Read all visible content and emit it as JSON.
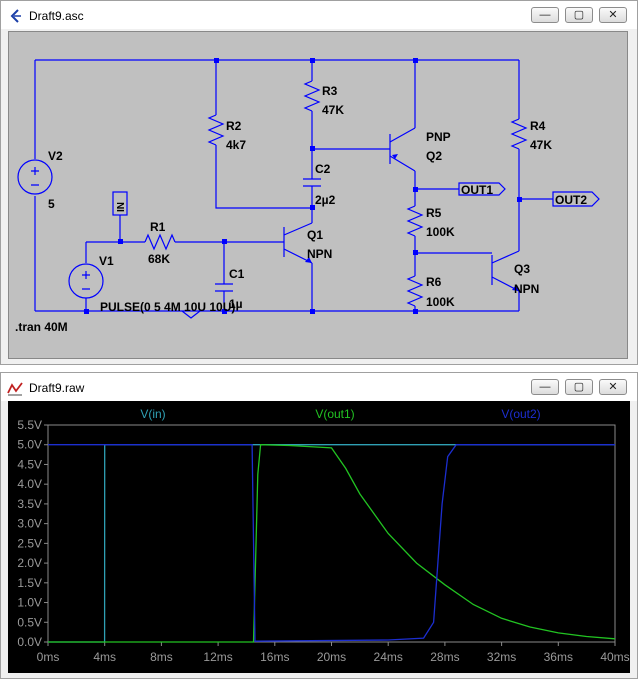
{
  "schematic_window": {
    "title": "Draft9.asc",
    "buttons": {
      "minimize": "—",
      "maximize": "▢",
      "close": "✕"
    },
    "labels": {
      "v2_name": "V2",
      "v2_value": "5",
      "r2_name": "R2",
      "r2_value": "4k7",
      "r3_name": "R3",
      "r3_value": "47K",
      "c2_name": "C2",
      "c2_value": "2µ2",
      "q2_name": "PNP",
      "q2_type": "Q2",
      "r4_name": "R4",
      "r4_value": "47K",
      "in_flag": "IN",
      "r1_name": "R1",
      "r1_value": "68K",
      "q1_name": "Q1",
      "q1_type": "NPN",
      "out1_flag": "OUT1",
      "out2_flag": "OUT2",
      "r5_name": "R5",
      "r5_value": "100K",
      "v1_name": "V1",
      "c1_name": "C1",
      "c1_value": "1µ",
      "r6_name": "R6",
      "r6_value": "100K",
      "q3_name": "Q3",
      "q3_type": "NPN",
      "pulse_text": "PULSE(0 5 4M 10U 10U)",
      "tran_text": ".tran 40M"
    }
  },
  "waveform_window": {
    "title": "Draft9.raw",
    "buttons": {
      "minimize": "—",
      "maximize": "▢",
      "close": "✕"
    }
  },
  "chart_data": {
    "type": "line",
    "title": "",
    "xlabel": "",
    "ylabel": "",
    "xlim": [
      0,
      40
    ],
    "ylim": [
      0,
      5.5
    ],
    "x_ticks": [
      "0ms",
      "4ms",
      "8ms",
      "12ms",
      "16ms",
      "20ms",
      "24ms",
      "28ms",
      "32ms",
      "36ms",
      "40ms"
    ],
    "y_ticks": [
      "0.0V",
      "0.5V",
      "1.0V",
      "1.5V",
      "2.0V",
      "2.5V",
      "3.0V",
      "3.5V",
      "4.0V",
      "4.5V",
      "5.0V",
      "5.5V"
    ],
    "grid": false,
    "background": "#000000",
    "series": [
      {
        "name": "V(in)",
        "color": "#2fa0b4",
        "x": [
          0,
          3.99,
          4.0,
          40
        ],
        "y": [
          0,
          0,
          5.0,
          5.0
        ]
      },
      {
        "name": "V(out1)",
        "color": "#22c322",
        "x": [
          0,
          14.5,
          14.8,
          15,
          17,
          20,
          21,
          22,
          24,
          26,
          28,
          30,
          32,
          34,
          36,
          38,
          40
        ],
        "y": [
          0,
          0,
          4.25,
          5.0,
          4.98,
          4.92,
          4.4,
          3.75,
          2.75,
          2.0,
          1.45,
          0.95,
          0.6,
          0.38,
          0.23,
          0.14,
          0.08
        ]
      },
      {
        "name": "V(out2)",
        "color": "#1c2ed0",
        "x": [
          0,
          3.99,
          4.0,
          14.4,
          14.6,
          24,
          26.5,
          27.2,
          27.8,
          28.2,
          28.8,
          40
        ],
        "y": [
          5.0,
          5.0,
          5.0,
          5.0,
          0.02,
          0.05,
          0.1,
          0.5,
          3.5,
          4.7,
          5.0,
          5.0
        ]
      }
    ]
  }
}
